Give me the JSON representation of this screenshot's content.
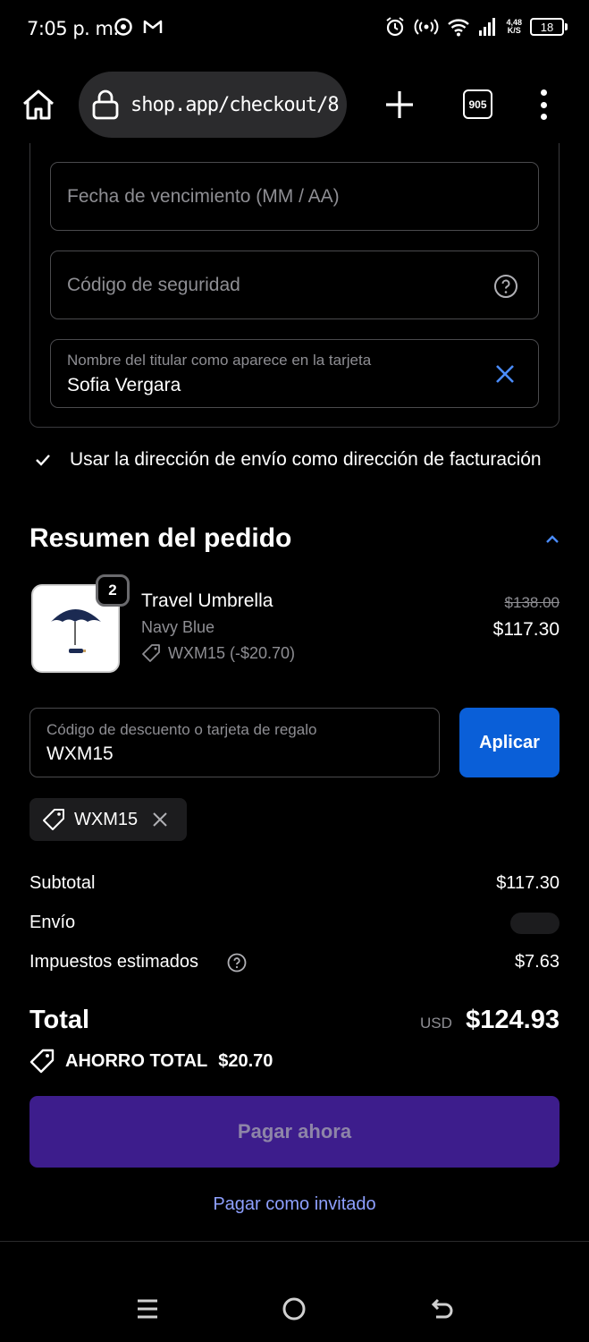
{
  "status_bar": {
    "time": "7:05 p. m.",
    "speed_value": "4,48",
    "speed_unit": "K/S",
    "battery": "18"
  },
  "browser": {
    "url": "shop.app/checkout/8",
    "tab_count": "905"
  },
  "payment_form": {
    "expiry_placeholder": "Fecha de vencimiento (MM / AA)",
    "security_code_placeholder": "Código de seguridad",
    "cardholder_label": "Nombre del titular como aparece en la tarjeta",
    "cardholder_value": "Sofia Vergara",
    "billing_same_label": "Usar la dirección de envío como dirección de facturación"
  },
  "summary": {
    "title": "Resumen del pedido",
    "product": {
      "name": "Travel Umbrella",
      "variant": "Navy Blue",
      "discount": "WXM15 (-$20.70)",
      "old_price": "$138.00",
      "price": "$117.30",
      "quantity": "2"
    },
    "discount_field_label": "Código de descuento o tarjeta de regalo",
    "discount_field_value": "WXM15",
    "apply_label": "Aplicar",
    "applied_code": "WXM15",
    "subtotal_label": "Subtotal",
    "subtotal_value": "$117.30",
    "shipping_label": "Envío",
    "taxes_label": "Impuestos estimados",
    "taxes_value": "$7.63",
    "total_label": "Total",
    "total_currency": "USD",
    "total_value": "$124.93",
    "savings_label": "AHORRO TOTAL",
    "savings_value": "$20.70",
    "pay_label": "Pagar ahora",
    "guest_label": "Pagar como invitado"
  },
  "colors": {
    "accent_blue": "#0a5fd8",
    "pay_button": "#3d1d8c",
    "link": "#8ea0ff"
  }
}
